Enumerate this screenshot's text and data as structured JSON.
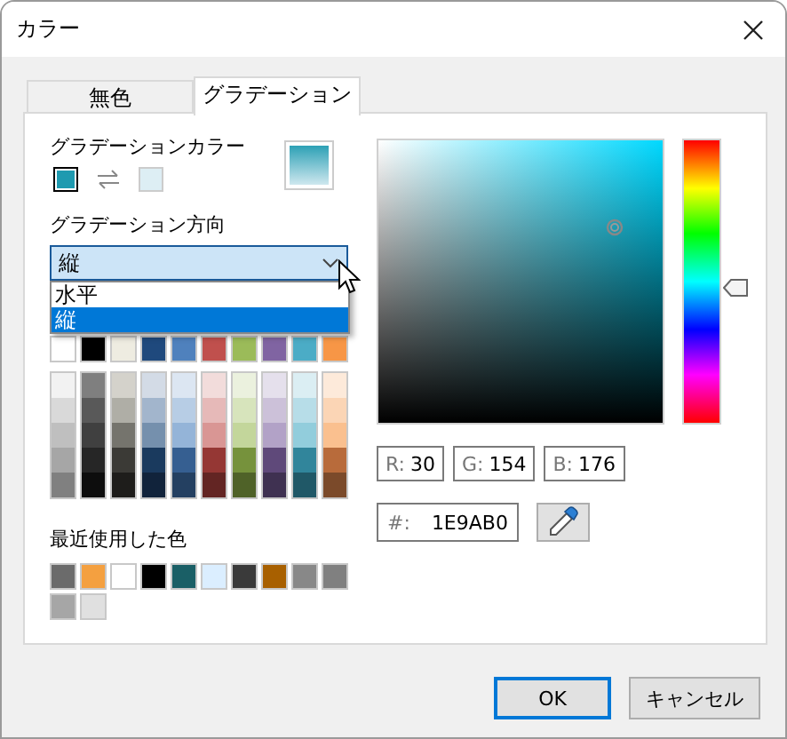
{
  "window": {
    "title": "カラー"
  },
  "tabs": [
    {
      "label": "無色",
      "selected": false
    },
    {
      "label": "グラデーション",
      "selected": true
    }
  ],
  "gradient": {
    "label": "グラデーションカラー",
    "colors": [
      {
        "color": "#1e9ab0",
        "selected": true
      },
      {
        "color": "#ddeef4",
        "selected": false
      }
    ]
  },
  "direction": {
    "label": "グラデーション方向",
    "value": "縦",
    "expanded": true,
    "options": [
      {
        "label": "水平",
        "selected": false
      },
      {
        "label": "縦",
        "selected": true
      }
    ]
  },
  "palette": [
    {
      "color": "#ffffff",
      "shades": [
        {
          "color": "#f2f2f2"
        },
        {
          "color": "#d9d9d9"
        },
        {
          "color": "#bfbfbf"
        },
        {
          "color": "#a6a6a6"
        },
        {
          "color": "#808080"
        }
      ]
    },
    {
      "color": "#000000",
      "shades": [
        {
          "color": "#7f7f7f"
        },
        {
          "color": "#595959"
        },
        {
          "color": "#404040"
        },
        {
          "color": "#262626"
        },
        {
          "color": "#0d0d0d"
        }
      ]
    },
    {
      "color": "#eeece1",
      "shades": [
        {
          "color": "#d4d2cb"
        },
        {
          "color": "#afaea6"
        },
        {
          "color": "#75746d"
        },
        {
          "color": "#3b3a36"
        },
        {
          "color": "#1e1d1b"
        }
      ]
    },
    {
      "color": "#1f497d",
      "shades": [
        {
          "color": "#d3dbe6"
        },
        {
          "color": "#a2b5cc"
        },
        {
          "color": "#7590ad"
        },
        {
          "color": "#1a3a5e"
        },
        {
          "color": "#11233b"
        }
      ]
    },
    {
      "color": "#4f81bd",
      "shades": [
        {
          "color": "#dce6f2"
        },
        {
          "color": "#b7cde5"
        },
        {
          "color": "#94b4d8"
        },
        {
          "color": "#365f91"
        },
        {
          "color": "#244061"
        }
      ]
    },
    {
      "color": "#c0504d",
      "shades": [
        {
          "color": "#f2dcdb"
        },
        {
          "color": "#e6b9b8"
        },
        {
          "color": "#d99694"
        },
        {
          "color": "#953734"
        },
        {
          "color": "#632523"
        }
      ]
    },
    {
      "color": "#9bbb59",
      "shades": [
        {
          "color": "#ebf1de"
        },
        {
          "color": "#d7e4bc"
        },
        {
          "color": "#c3d69b"
        },
        {
          "color": "#76923c"
        },
        {
          "color": "#4f6228"
        }
      ]
    },
    {
      "color": "#8064a2",
      "shades": [
        {
          "color": "#e5e0ec"
        },
        {
          "color": "#ccc1d9"
        },
        {
          "color": "#b2a2c7"
        },
        {
          "color": "#5f497a"
        },
        {
          "color": "#3f3151"
        }
      ]
    },
    {
      "color": "#4bacc6",
      "shades": [
        {
          "color": "#dbeef3"
        },
        {
          "color": "#b7dde8"
        },
        {
          "color": "#92cddc"
        },
        {
          "color": "#31859b"
        },
        {
          "color": "#205867"
        }
      ]
    },
    {
      "color": "#f79646",
      "shades": [
        {
          "color": "#fdeada"
        },
        {
          "color": "#fbd5b5"
        },
        {
          "color": "#fac08f"
        },
        {
          "color": "#b86b3b"
        },
        {
          "color": "#7b4a2a"
        }
      ]
    }
  ],
  "recent": {
    "label": "最近使用した色",
    "colors": [
      {
        "color": "#6b6b6b"
      },
      {
        "color": "#f4a040"
      },
      {
        "color": "#ffffff"
      },
      {
        "color": "#000000"
      },
      {
        "color": "#1a5f66"
      },
      {
        "color": "#dbeeff"
      },
      {
        "color": "#3a3a3a"
      },
      {
        "color": "#a86000"
      },
      {
        "color": "#888888"
      },
      {
        "color": "#808080"
      },
      {
        "color": "#a6a6a6"
      },
      {
        "color": "#e0e0e0"
      }
    ]
  },
  "picker": {
    "hue": {
      "level": 0.52
    },
    "rgb": [
      {
        "label": "R:",
        "value": "30"
      },
      {
        "label": "G:",
        "value": "154"
      },
      {
        "label": "B:",
        "value": "176"
      }
    ],
    "hex": {
      "label": "#:",
      "value": "1E9AB0"
    }
  },
  "buttons": [
    {
      "label": "OK",
      "kind": "default"
    },
    {
      "label": "キャンセル",
      "kind": "normal"
    }
  ]
}
